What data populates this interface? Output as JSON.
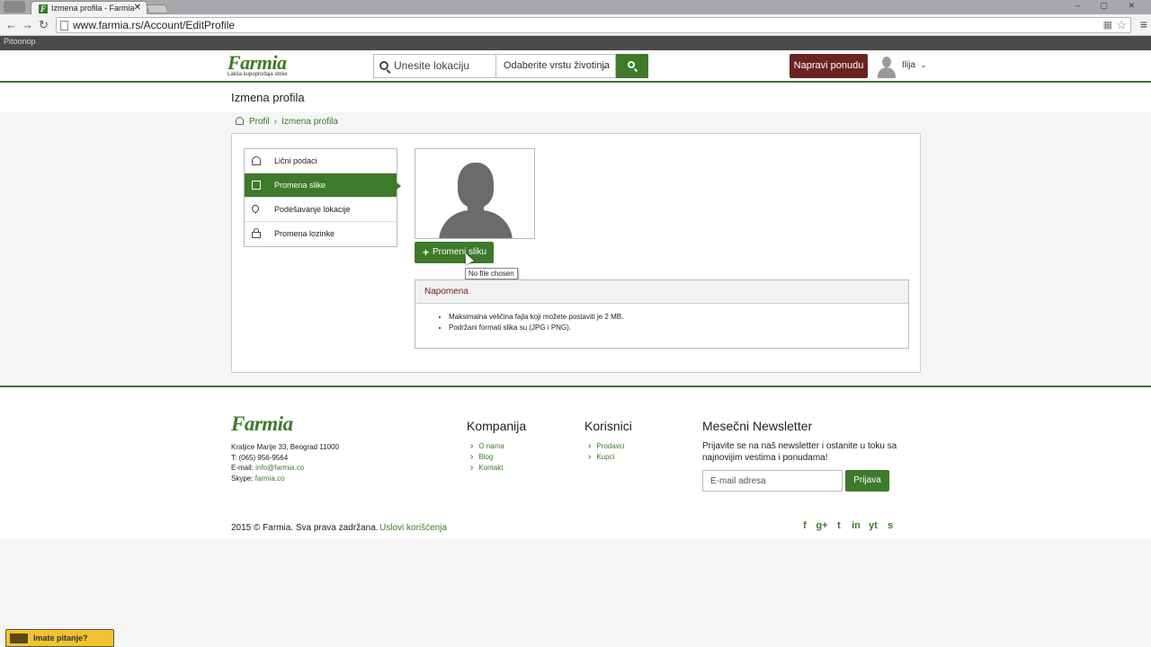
{
  "browser": {
    "tab_title": "Izmena profila - Farmia",
    "tab_favicon": "F",
    "tab_close": "✕",
    "url": "www.farmia.rs/Account/EditProfile",
    "window_controls": "‒ ▢ ✕",
    "bookmark": "Pitoonop"
  },
  "header": {
    "logo_text": "Farmia",
    "logo_slogan": "Lakša kupoprodaja stoke",
    "location_placeholder": "Unesite lokaciju",
    "animal_select": "Odaberite vrstu životinja",
    "offer_button": "Napravi ponudu",
    "user_name": "Ilija"
  },
  "page": {
    "title": "Izmena profila",
    "breadcrumb": {
      "root": "Profil",
      "sep": "›",
      "current": "Izmena profila"
    }
  },
  "side_menu": {
    "items": [
      {
        "label": "Lični podaci",
        "icon": "user-icon"
      },
      {
        "label": "Promena slike",
        "icon": "image-icon"
      },
      {
        "label": "Podešavanje lokacije",
        "icon": "map-pin-icon"
      },
      {
        "label": "Promena lozinke",
        "icon": "lock-icon"
      }
    ],
    "active_index": 1
  },
  "photo": {
    "change_button": "Promeni sliku",
    "tooltip": "No file chosen"
  },
  "note": {
    "title": "Napomena",
    "items": [
      "Maksimalna veličina fajla koji možete postaviti je 2 MB.",
      "Podržani formati slika su (JPG i PNG)."
    ]
  },
  "footer": {
    "logo_text": "Farmia",
    "address": "Kraljice Marije 33, Beograd 11000",
    "phone": "T: (065) 956-9564",
    "email_label": "E-mail:",
    "email": "info@farmia.co",
    "skype_label": "Skype:",
    "skype": "farmia.co",
    "company_title": "Kompanija",
    "company_links": [
      "O nama",
      "Blog",
      "Kontakt"
    ],
    "users_title": "Korisnici",
    "users_links": [
      "Prodavci",
      "Kupci"
    ],
    "newsletter_title": "Mesečni Newsletter",
    "newsletter_text": "Prijavite se na naš newsletter i ostanite u toku sa najnovijim vestima i ponudama!",
    "email_placeholder": "E-mail adresa",
    "signup_button": "Prijava",
    "copyright": "2015 © Farmia. Sva prava zadržana.",
    "terms": "Uslovi korišćenja",
    "social": [
      "f",
      "g+",
      "t",
      "in",
      "yt",
      "s"
    ]
  },
  "help_badge": "Imate pitanje?",
  "colors": {
    "brand_green": "#3d7a2a",
    "accent_maroon": "#6b2320"
  }
}
